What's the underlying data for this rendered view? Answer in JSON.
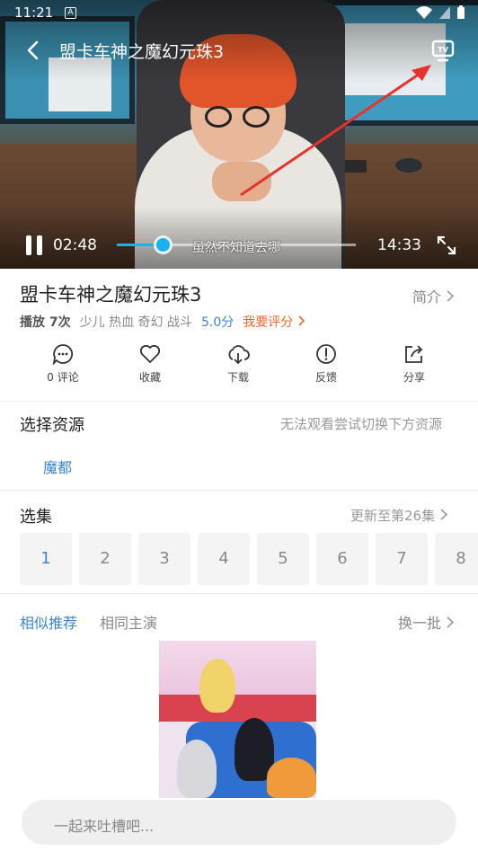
{
  "status_bar": {
    "time": "11:21",
    "notification_glyph": "A"
  },
  "player": {
    "title": "盟卡车神之魔幻元珠3",
    "current_time": "02:48",
    "total_time": "14:33",
    "subtitle": "虽然不知道去哪",
    "progress_fraction": 0.19,
    "accent_color": "#19b2ee",
    "icons": [
      "back-icon",
      "tv-cast-icon",
      "pause-icon",
      "fullscreen-icon"
    ]
  },
  "info": {
    "title": "盟卡车神之魔幻元珠3",
    "intro_label": "简介",
    "plays": "播放 7次",
    "tags": "少儿 热血 奇幻 战斗",
    "score": "5.0分",
    "rate_label": "我要评分"
  },
  "actions": [
    {
      "label": "0 评论",
      "icon": "comment-icon"
    },
    {
      "label": "收藏",
      "icon": "heart-icon"
    },
    {
      "label": "下载",
      "icon": "download-icon"
    },
    {
      "label": "反馈",
      "icon": "feedback-icon"
    },
    {
      "label": "分享",
      "icon": "share-icon"
    }
  ],
  "sources": {
    "label": "选择资源",
    "hint": "无法观看尝试切换下方资源",
    "items": [
      "魔都"
    ]
  },
  "episodes": {
    "label": "选集",
    "update_label": "更新至第26集",
    "items": [
      "1",
      "2",
      "3",
      "4",
      "5",
      "6",
      "7",
      "8"
    ],
    "active_index": 0
  },
  "recommend": {
    "tab_similar": "相似推荐",
    "tab_cast": "相同主演",
    "refresh_label": "换一批"
  },
  "comment": {
    "placeholder": "一起来吐槽吧..."
  },
  "colors": {
    "link_blue": "#3a86d4",
    "rate_orange": "#f0692a",
    "arrow_red": "#e8322b"
  }
}
